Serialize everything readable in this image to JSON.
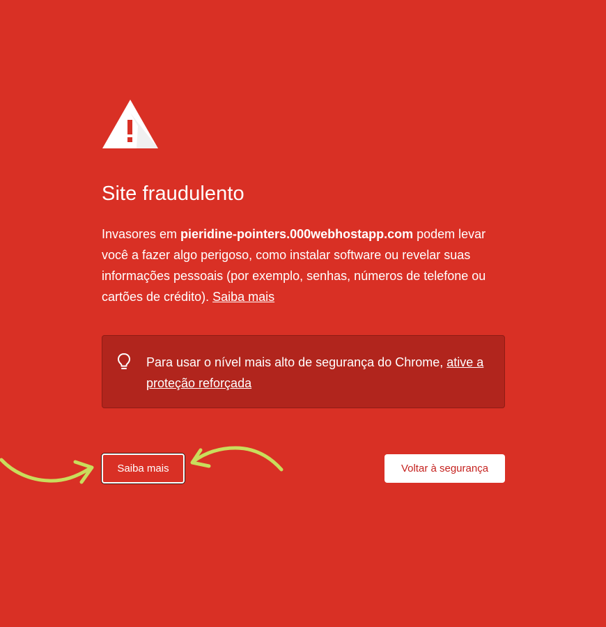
{
  "title": "Site fraudulento",
  "explanation": {
    "before": "Invasores em ",
    "domain": "pieridine-pointers.000webhostapp.com",
    "after": " podem levar você a fazer algo perigoso, como instalar software ou revelar suas informações pessoais (por exemplo, senhas, números de telefone ou cartões de crédito). ",
    "learn_more_link": "Saiba mais"
  },
  "enhanced_protection": {
    "text": "Para usar o nível mais alto de segurança do Chrome, ",
    "link": "ative a proteção reforçada"
  },
  "buttons": {
    "details": "Saiba mais",
    "back_to_safety": "Voltar à segurança"
  },
  "icons": {
    "warning": "warning-triangle-icon",
    "lightbulb": "lightbulb-icon",
    "annotation_arrows": "annotation-arrow"
  },
  "colors": {
    "background": "#d93025",
    "callout_background": "#b1251d",
    "back_button_text": "#c5221f",
    "annotation_arrow": "#c9dd5c"
  }
}
